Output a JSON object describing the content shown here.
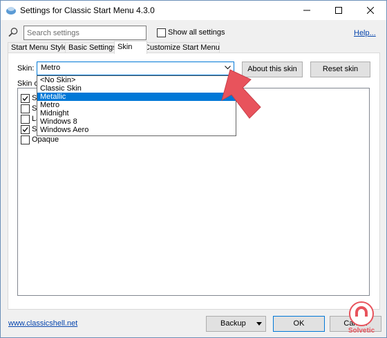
{
  "window": {
    "title": "Settings for Classic Start Menu 4.3.0",
    "minimize_glyph": "—",
    "maximize_glyph": "☐",
    "close_glyph": "✕"
  },
  "toolbar": {
    "search_placeholder": "Search settings",
    "show_all_label": "Show all settings",
    "show_all_checked": false,
    "help_label": "Help..."
  },
  "tabs": [
    {
      "label": "Start Menu Style",
      "active": false
    },
    {
      "label": "Basic Settings",
      "active": false
    },
    {
      "label": "Skin",
      "active": true
    },
    {
      "label": "Customize Start Menu",
      "active": false
    }
  ],
  "skin": {
    "label": "Skin:",
    "selected": "Metro",
    "about_button": "About this skin",
    "reset_button": "Reset skin",
    "dropdown_options": [
      "<No Skin>",
      "Classic Skin",
      "Metallic",
      "Metro",
      "Midnight",
      "Windows 8",
      "Windows Aero"
    ],
    "highlighted_index": 2
  },
  "skin_options": {
    "heading": "Skin op",
    "items": [
      {
        "label": "Sh",
        "checked": true
      },
      {
        "label": "Sn",
        "checked": false
      },
      {
        "label": "La",
        "checked": false
      },
      {
        "label": "Sh",
        "checked": true
      },
      {
        "label": "Opaque",
        "checked": false
      }
    ]
  },
  "footer": {
    "site_link": "www.classicshell.net",
    "backup_label": "Backup",
    "ok_label": "OK",
    "cancel_label": "Cancel"
  },
  "watermark": {
    "brand": "Solvetic"
  },
  "colors": {
    "accent": "#0078d7",
    "pointer": "#e8535c",
    "link": "#0645ad"
  }
}
